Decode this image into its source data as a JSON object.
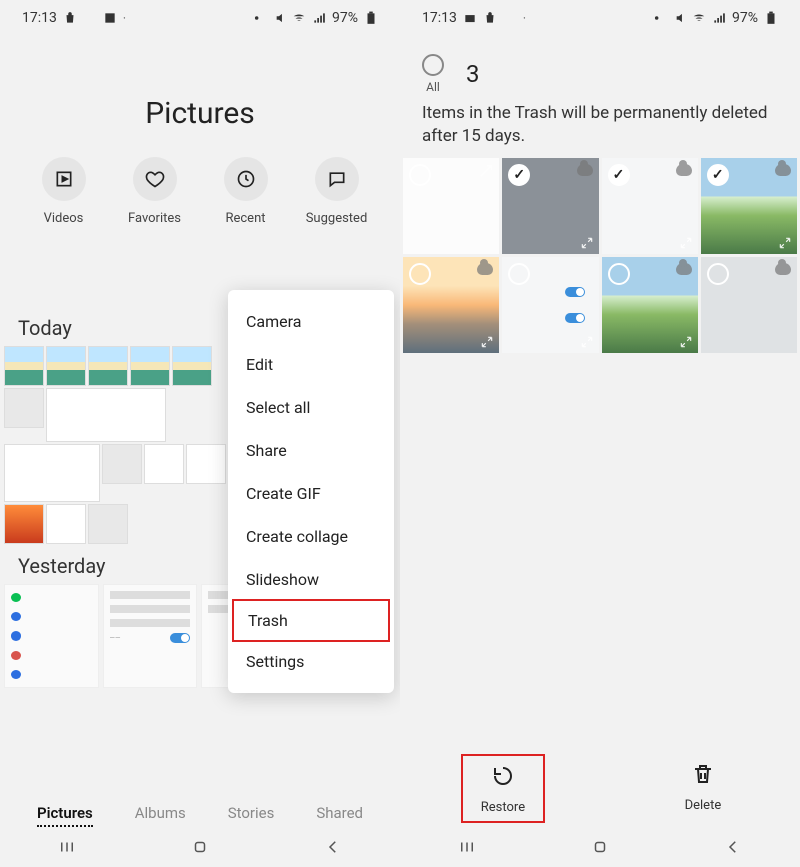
{
  "status": {
    "time": "17:13",
    "battery": "97%"
  },
  "left": {
    "title": "Pictures",
    "categories": [
      {
        "label": "Videos",
        "icon": "play-icon"
      },
      {
        "label": "Favorites",
        "icon": "heart-icon"
      },
      {
        "label": "Recent",
        "icon": "clock-icon"
      },
      {
        "label": "Suggested",
        "icon": "chat-icon"
      }
    ],
    "sections": {
      "today": "Today",
      "yesterday": "Yesterday"
    },
    "menu": [
      "Camera",
      "Edit",
      "Select all",
      "Share",
      "Create GIF",
      "Create collage",
      "Slideshow",
      "Trash",
      "Settings"
    ],
    "tabs": [
      {
        "label": "Pictures",
        "active": true
      },
      {
        "label": "Albums",
        "active": false
      },
      {
        "label": "Stories",
        "active": false
      },
      {
        "label": "Shared",
        "active": false
      }
    ]
  },
  "right": {
    "select_all_label": "All",
    "selected_count": "3",
    "message": "Items in the Trash will be permanently deleted after 15 days.",
    "actions": {
      "restore": "Restore",
      "delete": "Delete"
    }
  }
}
